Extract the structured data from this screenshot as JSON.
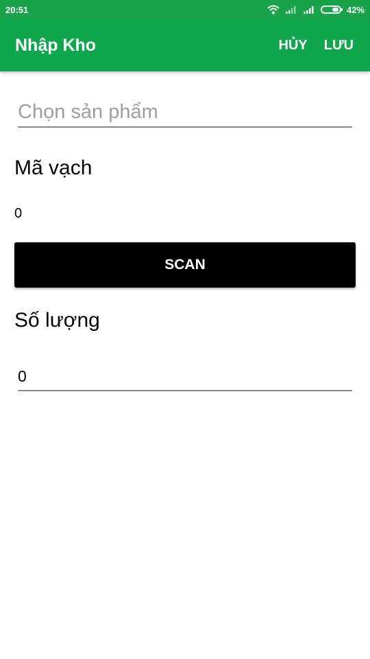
{
  "status_bar": {
    "time": "20:51",
    "battery_text": "42%",
    "battery_level": 0.42,
    "icons": [
      "wifi-icon",
      "signal-icon",
      "signal-icon",
      "battery-icon"
    ]
  },
  "app_bar": {
    "title": "Nhập Kho",
    "cancel_label": "HỦY",
    "save_label": "LƯU"
  },
  "form": {
    "product": {
      "placeholder": "Chọn sản phẩm",
      "value": ""
    },
    "barcode": {
      "label": "Mã vạch",
      "value": "0"
    },
    "scan_label": "SCAN",
    "quantity": {
      "label": "Số lượng",
      "value": "0"
    }
  },
  "colors": {
    "status_bar": "#1aa34a",
    "app_bar": "#0fa64e",
    "scan_button": "#000000",
    "underline": "#8a8a8a"
  }
}
